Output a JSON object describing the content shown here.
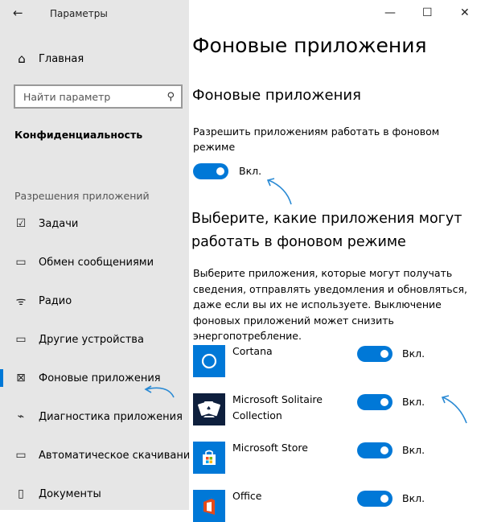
{
  "window": {
    "title": "Параметры",
    "back_icon": "←",
    "minimize_icon": "—",
    "maximize_icon": "☐",
    "close_icon": "✕"
  },
  "sidebar": {
    "home_icon": "⌂",
    "home_label": "Главная",
    "search_placeholder": "Найти параметр",
    "search_icon": "⚲",
    "section_title": "Конфиденциальность",
    "group_title": "Разрешения приложений",
    "items": [
      {
        "label": "Задачи",
        "icon": "☑"
      },
      {
        "label": "Обмен сообщениями",
        "icon": "▭"
      },
      {
        "label": "Радио",
        "icon": "ᯤ"
      },
      {
        "label": "Другие устройства",
        "icon": "▭"
      },
      {
        "label": "Фоновые приложения",
        "icon": "⊠"
      },
      {
        "label": "Диагностика приложения",
        "icon": "⌁"
      },
      {
        "label": "Автоматическое скачивание",
        "icon": "▭"
      },
      {
        "label": "Документы",
        "icon": "▯"
      }
    ],
    "active_index": 4
  },
  "main": {
    "page_title": "Фоновые приложения",
    "section_title": "Фоновые приложения",
    "allow_text": "Разрешить приложениям работать в фоновом режиме",
    "allow_state": "Вкл.",
    "choose_heading": "Выберите, какие приложения могут работать в фоновом режиме",
    "choose_desc": "Выберите приложения, которые могут получать сведения, отправлять уведомления и обновляться, даже если вы их не используете. Выключение фоновых приложений может снизить энергопотребление.",
    "apps": [
      {
        "name": "Cortana",
        "state": "Вкл.",
        "tile_color": "#0078d7",
        "icon": "cortana-icon"
      },
      {
        "name": "Microsoft Solitaire Collection",
        "state": "Вкл.",
        "tile_color": "#0e1f3d",
        "icon": "cards-icon"
      },
      {
        "name": "Microsoft Store",
        "state": "Вкл.",
        "tile_color": "#0078d7",
        "icon": "store-bag-icon"
      },
      {
        "name": "Office",
        "state": "Вкл.",
        "tile_color": "#0078d7",
        "icon": "office-icon"
      }
    ]
  },
  "colors": {
    "accent": "#0078d7",
    "sidebar_bg": "#e6e6e6",
    "annotation_arrow": "#2a8ad4"
  }
}
